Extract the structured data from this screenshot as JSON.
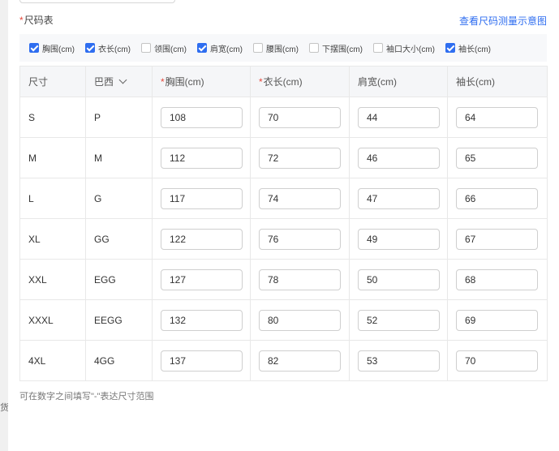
{
  "section": {
    "required_mark": "*",
    "title": "尺码表",
    "link": "查看尺码测量示意图"
  },
  "options": [
    {
      "label": "胸围(cm)",
      "checked": true
    },
    {
      "label": "衣长(cm)",
      "checked": true
    },
    {
      "label": "领围(cm)",
      "checked": false
    },
    {
      "label": "肩宽(cm)",
      "checked": true
    },
    {
      "label": "腰围(cm)",
      "checked": false
    },
    {
      "label": "下摆围(cm)",
      "checked": false
    },
    {
      "label": "袖口大小(cm)",
      "checked": false
    },
    {
      "label": "袖长(cm)",
      "checked": true
    }
  ],
  "table": {
    "headers": {
      "size": "尺寸",
      "region": "巴西",
      "chest_star": "*",
      "chest": "胸围(cm)",
      "length_star": "*",
      "length": "衣长(cm)",
      "shoulder": "肩宽(cm)",
      "sleeve": "袖长(cm)"
    },
    "rows": [
      {
        "size": "S",
        "region": "P",
        "chest": "108",
        "length": "70",
        "shoulder": "44",
        "sleeve": "64"
      },
      {
        "size": "M",
        "region": "M",
        "chest": "112",
        "length": "72",
        "shoulder": "46",
        "sleeve": "65"
      },
      {
        "size": "L",
        "region": "G",
        "chest": "117",
        "length": "74",
        "shoulder": "47",
        "sleeve": "66"
      },
      {
        "size": "XL",
        "region": "GG",
        "chest": "122",
        "length": "76",
        "shoulder": "49",
        "sleeve": "67"
      },
      {
        "size": "XXL",
        "region": "EGG",
        "chest": "127",
        "length": "78",
        "shoulder": "50",
        "sleeve": "68"
      },
      {
        "size": "XXXL",
        "region": "EEGG",
        "chest": "132",
        "length": "80",
        "shoulder": "52",
        "sleeve": "69"
      },
      {
        "size": "4XL",
        "region": "4GG",
        "chest": "137",
        "length": "82",
        "shoulder": "53",
        "sleeve": "70"
      }
    ]
  },
  "hint": "可在数字之间填写\"-\"表达尺寸范围",
  "left_cut_char": "货",
  "colors": {
    "accent": "#2f6ef0",
    "required": "#e5483c"
  }
}
